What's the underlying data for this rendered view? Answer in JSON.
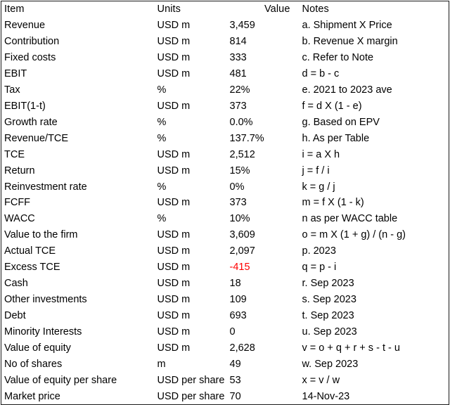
{
  "table": {
    "columns": [
      {
        "key": "item",
        "label": "Item"
      },
      {
        "key": "units",
        "label": "Units"
      },
      {
        "key": "value",
        "label": "Value"
      },
      {
        "key": "notes",
        "label": "Notes"
      }
    ],
    "rows": [
      {
        "item": "Revenue",
        "units": "USD m",
        "value": "3,459",
        "notes": "a. Shipment X Price",
        "negative": false
      },
      {
        "item": "Contribution",
        "units": "USD m",
        "value": "814",
        "notes": "b. Revenue X margin",
        "negative": false
      },
      {
        "item": "Fixed costs",
        "units": "USD m",
        "value": "333",
        "notes": "c. Refer to Note",
        "negative": false
      },
      {
        "item": "EBIT",
        "units": "USD m",
        "value": "481",
        "notes": "d = b - c",
        "negative": false
      },
      {
        "item": "Tax",
        "units": "%",
        "value": "22%",
        "notes": "e. 2021 to 2023 ave",
        "negative": false
      },
      {
        "item": "EBIT(1-t)",
        "units": "USD m",
        "value": "373",
        "notes": "f = d X (1 - e)",
        "negative": false
      },
      {
        "item": "Growth rate",
        "units": "%",
        "value": "0.0%",
        "notes": "g. Based on EPV",
        "negative": false
      },
      {
        "item": "Revenue/TCE",
        "units": "%",
        "value": "137.7%",
        "notes": "h. As per Table",
        "negative": false
      },
      {
        "item": "TCE",
        "units": "USD m",
        "value": "2,512",
        "notes": "i = a X h",
        "negative": false
      },
      {
        "item": "Return",
        "units": "USD m",
        "value": "15%",
        "notes": "j = f / i",
        "negative": false
      },
      {
        "item": "Reinvestment rate",
        "units": "%",
        "value": "0%",
        "notes": "k = g / j",
        "negative": false
      },
      {
        "item": "FCFF",
        "units": "USD m",
        "value": "373",
        "notes": "m = f X (1 - k)",
        "negative": false
      },
      {
        "item": "WACC",
        "units": "%",
        "value": "10%",
        "notes": "n as per WACC table",
        "negative": false
      },
      {
        "item": "Value to the firm",
        "units": "USD m",
        "value": "3,609",
        "notes": "o = m X (1 + g) / (n - g)",
        "negative": false
      },
      {
        "item": "Actual TCE",
        "units": "USD m",
        "value": "2,097",
        "notes": "p. 2023",
        "negative": false
      },
      {
        "item": "Excess TCE",
        "units": "USD m",
        "value": "-415",
        "notes": "q = p - i",
        "negative": true
      },
      {
        "item": "Cash",
        "units": "USD m",
        "value": "18",
        "notes": "r. Sep 2023",
        "negative": false
      },
      {
        "item": "Other investments",
        "units": "USD m",
        "value": "109",
        "notes": "s. Sep 2023",
        "negative": false
      },
      {
        "item": "Debt",
        "units": "USD m",
        "value": "693",
        "notes": "t. Sep 2023",
        "negative": false
      },
      {
        "item": "Minority Interests",
        "units": "USD m",
        "value": "0",
        "notes": "u. Sep 2023",
        "negative": false
      },
      {
        "item": "Value of equity",
        "units": "USD m",
        "value": "2,628",
        "notes": "v = o + q + r + s - t - u",
        "negative": false
      },
      {
        "item": "No of shares",
        "units": "m",
        "value": "49",
        "notes": "w. Sep 2023",
        "negative": false
      },
      {
        "item": "Value of equity per share",
        "units": "USD per share",
        "value": "53",
        "notes": "x = v / w",
        "negative": false
      },
      {
        "item": "Market price",
        "units": "USD per share",
        "value": "70",
        "notes": "14-Nov-23",
        "negative": false
      }
    ]
  },
  "colors": {
    "negative_value": "#ff0000",
    "text": "#000000",
    "border": "#1a1a1a"
  }
}
